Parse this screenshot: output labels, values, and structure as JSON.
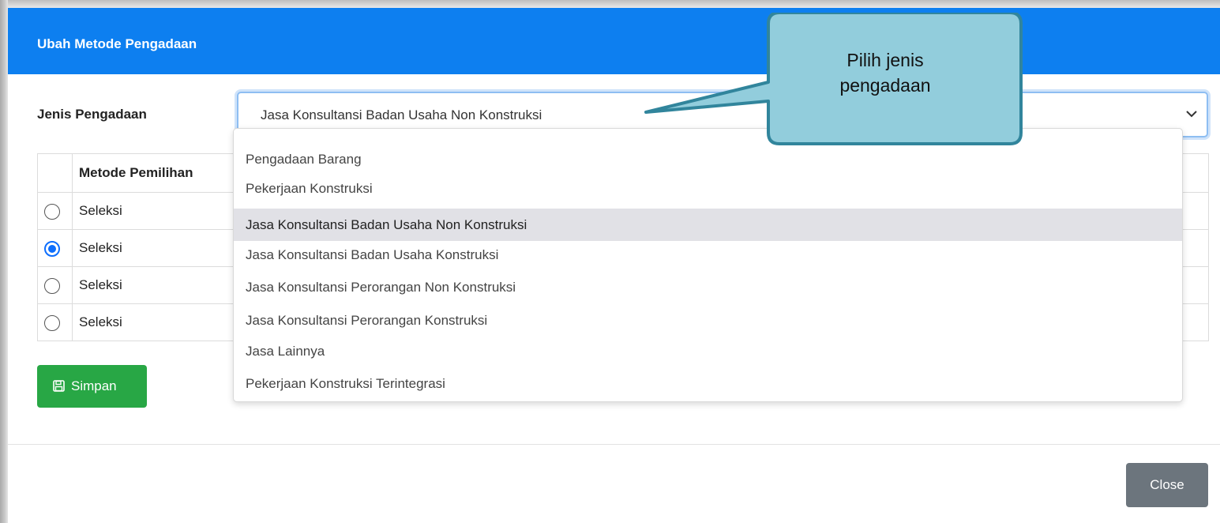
{
  "dialog": {
    "title": "Ubah Metode Pengadaan",
    "header_color": "#0d7ff0"
  },
  "form": {
    "jenis_label": "Jenis Pengadaan",
    "jenis_selected": "Jasa Konsultansi Badan Usaha Non Konstruksi"
  },
  "dropdown": {
    "options": [
      "Pengadaan Barang",
      "Pekerjaan Konstruksi",
      "Jasa Konsultansi Badan Usaha Non Konstruksi",
      "Jasa Konsultansi Badan Usaha Konstruksi",
      "Jasa Konsultansi Perorangan Non Konstruksi",
      "Jasa Konsultansi Perorangan Konstruksi",
      "Jasa Lainnya",
      "Pekerjaan Konstruksi Terintegrasi"
    ],
    "highlighted_index": 2
  },
  "table": {
    "header": "Metode Pemilihan",
    "rows": [
      {
        "label": "Seleksi",
        "checked": false
      },
      {
        "label": "Seleksi",
        "checked": true
      },
      {
        "label": "Seleksi",
        "checked": false
      },
      {
        "label": "Seleksi",
        "checked": false
      }
    ]
  },
  "buttons": {
    "save_label": "Simpan",
    "save_color": "#28a745",
    "close_label": "Close",
    "close_color": "#6c757d"
  },
  "callout": {
    "line1": "Pilih jenis",
    "line2": "pengadaan",
    "fill_color": "#92cddc",
    "border_color": "#31859c"
  },
  "icons": {
    "chevron": "chevron-down-icon",
    "save": "floppy-disk-icon",
    "radio": "radio-icon"
  }
}
